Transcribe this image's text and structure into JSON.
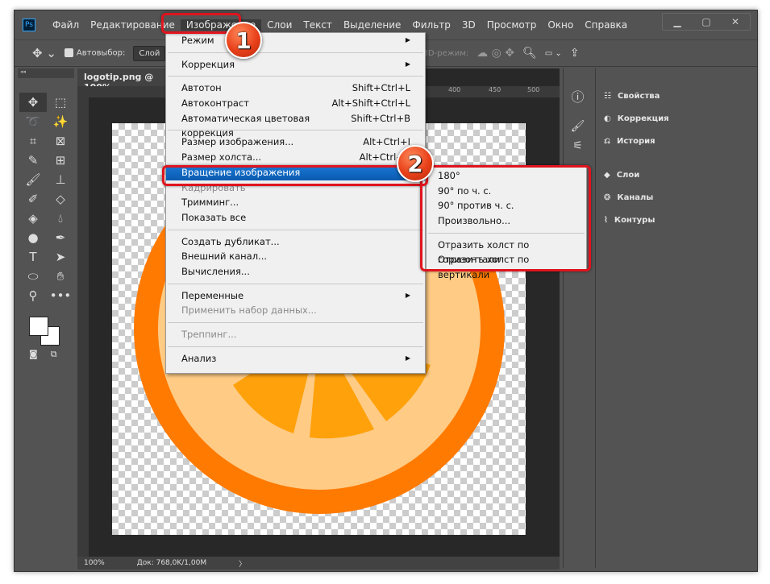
{
  "menubar": {
    "items": [
      "Файл",
      "Редактирование",
      "Изображение",
      "Слои",
      "Текст",
      "Выделение",
      "Фильтр",
      "3D",
      "Просмотр",
      "Окно",
      "Справка"
    ]
  },
  "options": {
    "autoselect": "Автовыбор:",
    "layer_select": "Слой",
    "mode3d": "3D-режим:"
  },
  "document": {
    "tab": "logotip.png @ 100%",
    "zoom": "100%",
    "doc_info": "Док: 768,0K/1,00M",
    "ruler_ticks": [
      "400",
      "450",
      "500"
    ]
  },
  "panels": [
    "Свойства",
    "Коррекция",
    "История",
    "Слои",
    "Каналы",
    "Контуры"
  ],
  "image_menu": [
    {
      "label": "Режим",
      "submenu": true
    },
    {
      "sep": true
    },
    {
      "label": "Коррекция",
      "submenu": true
    },
    {
      "sep": true
    },
    {
      "label": "Автотон",
      "shortcut": "Shift+Ctrl+L"
    },
    {
      "label": "Автоконтраст",
      "shortcut": "Alt+Shift+Ctrl+L"
    },
    {
      "label": "Автоматическая цветовая коррекция",
      "shortcut": "Shift+Ctrl+B"
    },
    {
      "sep": true
    },
    {
      "label": "Размер изображения...",
      "shortcut": "Alt+Ctrl+I"
    },
    {
      "label": "Размер холста...",
      "shortcut": "Alt+Ctrl+C"
    },
    {
      "label": "Вращение изображения",
      "submenu": true,
      "highlight": true
    },
    {
      "label": "Кадрировать",
      "disabled": true
    },
    {
      "label": "Тримминг..."
    },
    {
      "label": "Показать все"
    },
    {
      "sep": true
    },
    {
      "label": "Создать дубликат..."
    },
    {
      "label": "Внешний канал..."
    },
    {
      "label": "Вычисления..."
    },
    {
      "sep": true
    },
    {
      "label": "Переменные",
      "submenu": true
    },
    {
      "label": "Применить набор данных...",
      "disabled": true
    },
    {
      "sep": true
    },
    {
      "label": "Треппинг...",
      "disabled": true
    },
    {
      "sep": true
    },
    {
      "label": "Анализ",
      "submenu": true
    }
  ],
  "rotate_submenu": [
    "180°",
    "90° по ч. с.",
    "90° против ч. с.",
    "Произвольно...",
    null,
    "Отразить холст по горизонтали",
    "Отразить холст по вертикали"
  ],
  "badges": [
    "1",
    "2"
  ],
  "colors": {
    "highlight": "#0a64c4",
    "annotation": "#e0141e",
    "orange_outer": "#ff7a00",
    "orange_pulp": "#ffa10a",
    "orange_pith": "#ffcb85"
  }
}
